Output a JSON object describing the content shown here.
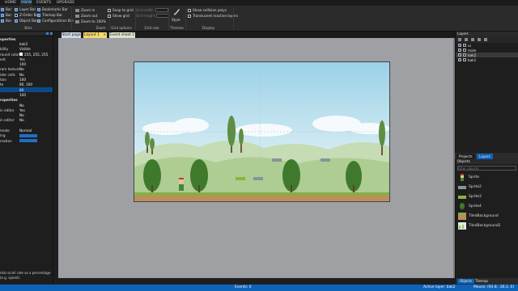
{
  "menubar": {
    "tabs": [
      "HOME",
      "VIEW",
      "EVENTS",
      "UPGRADE"
    ],
    "active": "VIEW"
  },
  "ribbon": {
    "bars_group": {
      "label": "Bars",
      "items": [
        {
          "label": "Bar",
          "checked": true
        },
        {
          "label": "Layer Bar",
          "checked": true
        },
        {
          "label": "Bookmarks Bar",
          "checked": true
        },
        {
          "label": "Bar",
          "checked": true
        },
        {
          "label": "Z-Order Bar",
          "checked": false
        },
        {
          "label": "Tilemap Bar",
          "checked": true
        },
        {
          "label": "Bar",
          "checked": true
        },
        {
          "label": "Object Bar",
          "checked": true
        },
        {
          "label": "Configurations Bar",
          "checked": true
        }
      ]
    },
    "zoom_group": {
      "label": "Zoom",
      "zoom_in": "Zoom in",
      "zoom_out": "Zoom out",
      "zoom_100": "Zoom to 100%"
    },
    "grid_options_group": {
      "label": "Grid options",
      "snap": "Snap to grid",
      "show": "Show grid"
    },
    "grid_size_group": {
      "label": "Grid size",
      "width": "Grid width",
      "height": "Grid height"
    },
    "themes_group": {
      "label": "Themes",
      "style": "Style"
    },
    "display_group": {
      "label": "Display",
      "collision": "Show collision polys",
      "translucent": "Translucent inactive layers"
    }
  },
  "properties": {
    "rows": [
      {
        "k": "operties",
        "v": "",
        "type": "head"
      },
      {
        "k": "",
        "v": "bak2"
      },
      {
        "k": "bility",
        "v": "Visible"
      },
      {
        "k": "round color",
        "v": "255, 255, 255",
        "swatch": "#ffffff"
      },
      {
        "k": "ent",
        "v": "Yes"
      },
      {
        "k": "",
        "v": "100"
      },
      {
        "k": "ram texture",
        "v": "No"
      },
      {
        "k": "ider cells",
        "v": "No"
      },
      {
        "k": "tion",
        "v": "100"
      },
      {
        "k": "te",
        "v": "80, 100"
      },
      {
        "k": "",
        "v": "80",
        "type": "sel"
      },
      {
        "k": "",
        "v": "100"
      },
      {
        "k": "roperties",
        "v": "",
        "type": "head"
      },
      {
        "k": "",
        "v": "No"
      },
      {
        "k": "in editor",
        "v": "Yes"
      },
      {
        "k": "",
        "v": "No"
      },
      {
        "k": "in editor",
        "v": "No"
      },
      {
        "k": "",
        "v": ""
      },
      {
        "k": "mode",
        "v": "Normal"
      },
      {
        "k": "ing",
        "v": "",
        "type": "bluebox"
      },
      {
        "k": "mation",
        "v": "",
        "type": "bluebox"
      }
    ],
    "description": "ntal scroll rate as a percentage (e.g. speed)."
  },
  "doc_tabs": [
    {
      "label": "Start page",
      "active": false
    },
    {
      "label": "Layout 1",
      "active": true,
      "close": "×"
    },
    {
      "label": "Event sheet 1",
      "active": false
    }
  ],
  "layers": {
    "title": "Layers",
    "items": [
      {
        "label": "ui",
        "selected": false
      },
      {
        "label": "main",
        "selected": false
      },
      {
        "label": "bak2",
        "selected": true
      },
      {
        "label": "bak1",
        "selected": false
      }
    ]
  },
  "project_tabs": [
    "Projects",
    "Layers"
  ],
  "objects": {
    "title": "Objects",
    "filter_placeholder": "Filter objects",
    "items": [
      {
        "label": "Sprite",
        "icon": "character-icon"
      },
      {
        "label": "Sprite2",
        "icon": "metal-block-icon"
      },
      {
        "label": "Sprite3",
        "icon": "grass-block-icon"
      },
      {
        "label": "Sprite4",
        "icon": "tree-icon"
      },
      {
        "label": "TiledBackground",
        "icon": "dirt-tile-icon"
      },
      {
        "label": "TiledBackground2",
        "icon": "grass-tile-icon"
      }
    ]
  },
  "bottom_tabs": [
    "Objects",
    "Tilemap"
  ],
  "status": {
    "events": "Events: 0",
    "active_layer": "Active layer: bak2",
    "mouse": "Mouse: (93.8, -26.2, 0)"
  },
  "colors": {
    "accent": "#0e63b8",
    "selection": "#0b4a86",
    "ground": "#b98f5c",
    "grass": "#79b545",
    "tree": "#3f7a2c"
  }
}
